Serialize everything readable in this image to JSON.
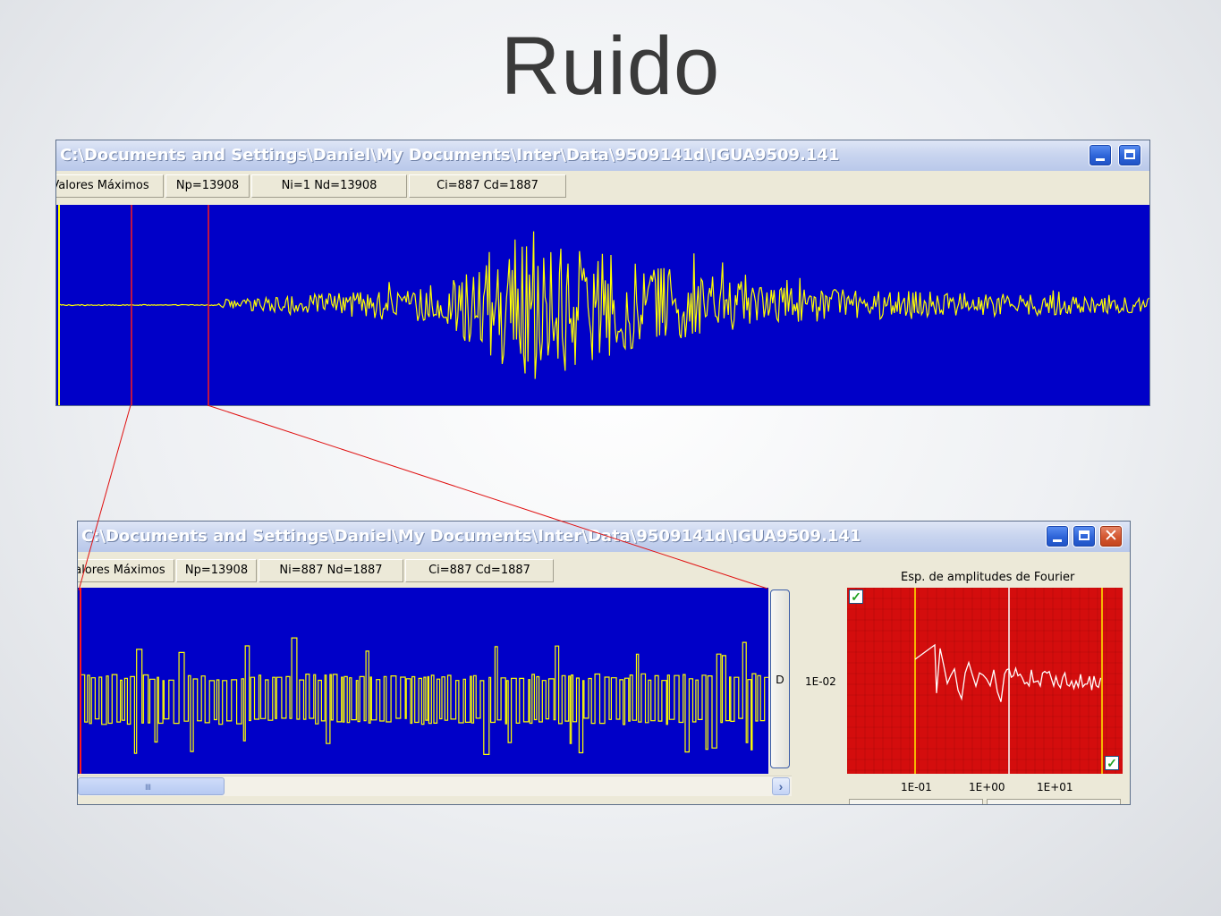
{
  "slide": {
    "title": "Ruido"
  },
  "window_top": {
    "title": "C:\\Documents and Settings\\Daniel\\My Documents\\Inter\\Data\\9509141d\\IGUA9509.141",
    "status": [
      "Valores Máximos",
      "Np=13908",
      "Ni=1 Nd=13908",
      "Ci=887 Cd=1887"
    ]
  },
  "window_bottom": {
    "title": "C:\\Documents and Settings\\Daniel\\My Documents\\Inter\\Data\\9509141d\\IGUA9509.141",
    "status": [
      "Valores Máximos",
      "Np=13908",
      "Ni=887 Nd=1887",
      "Ci=887 Cd=1887"
    ],
    "d_button": "D",
    "side_value": "1E-02",
    "scroll_grip": "IIII",
    "fourier": {
      "title": "Esp. de amplitudes de Fourier",
      "ticks": [
        "1E-01",
        "1E+00",
        "1E+01"
      ]
    }
  },
  "colors": {
    "plot_bg": "#0000c8",
    "trace": "#ffff00",
    "marker": "#ff1a1a",
    "fourier_bg": "#d40d0d",
    "fourier_trace": "#ffffff"
  },
  "icons": [
    "minimize-icon",
    "maximize-icon",
    "close-icon",
    "checkbox-checked-icon",
    "scroll-right-arrow-icon"
  ]
}
